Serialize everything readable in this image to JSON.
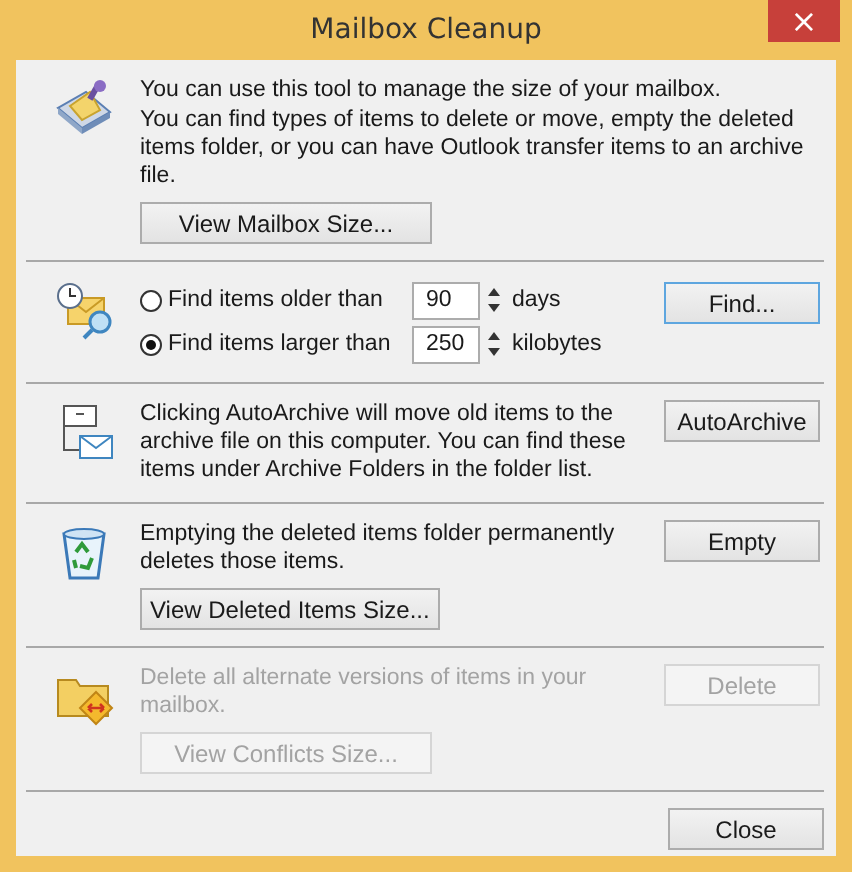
{
  "window": {
    "title": "Mailbox Cleanup",
    "close": "×"
  },
  "sections": [
    {
      "kind": "overview",
      "disabled": false,
      "text": [
        "You can use this tool to manage the size of your mailbox.",
        "You can find types of items to delete or move, empty the deleted items folder, or you can have Outlook transfer items to an archive file."
      ],
      "inline_button": {
        "label": "View Mailbox Size...",
        "disabled": false
      }
    },
    {
      "kind": "find",
      "disabled": false,
      "options": [
        {
          "label": "Find items older than",
          "selected": false,
          "value": "90",
          "unit": "days"
        },
        {
          "label": "Find items larger than",
          "selected": true,
          "value": "250",
          "unit": "kilobytes"
        }
      ],
      "side_button": {
        "label": "Find...",
        "disabled": false,
        "focused": true
      }
    },
    {
      "kind": "autoarchive",
      "disabled": false,
      "text": [
        "Clicking AutoArchive will move old items to the archive file on this computer. You can find these items under Archive Folders in the folder list."
      ],
      "side_button": {
        "label": "AutoArchive",
        "disabled": false,
        "focused": false
      }
    },
    {
      "kind": "deleted",
      "disabled": false,
      "text": [
        "Emptying the deleted items folder permanently deletes those items."
      ],
      "side_button": {
        "label": "Empty",
        "disabled": false,
        "focused": false
      },
      "inline_button": {
        "label": "View Deleted Items Size...",
        "disabled": false
      }
    },
    {
      "kind": "conflicts",
      "disabled": true,
      "text": [
        "Delete all alternate versions of items in your mailbox."
      ],
      "side_button": {
        "label": "Delete",
        "disabled": true,
        "focused": false
      },
      "inline_button": {
        "label": "View Conflicts Size...",
        "disabled": true
      }
    }
  ],
  "footer_button": {
    "label": "Close",
    "disabled": false
  }
}
